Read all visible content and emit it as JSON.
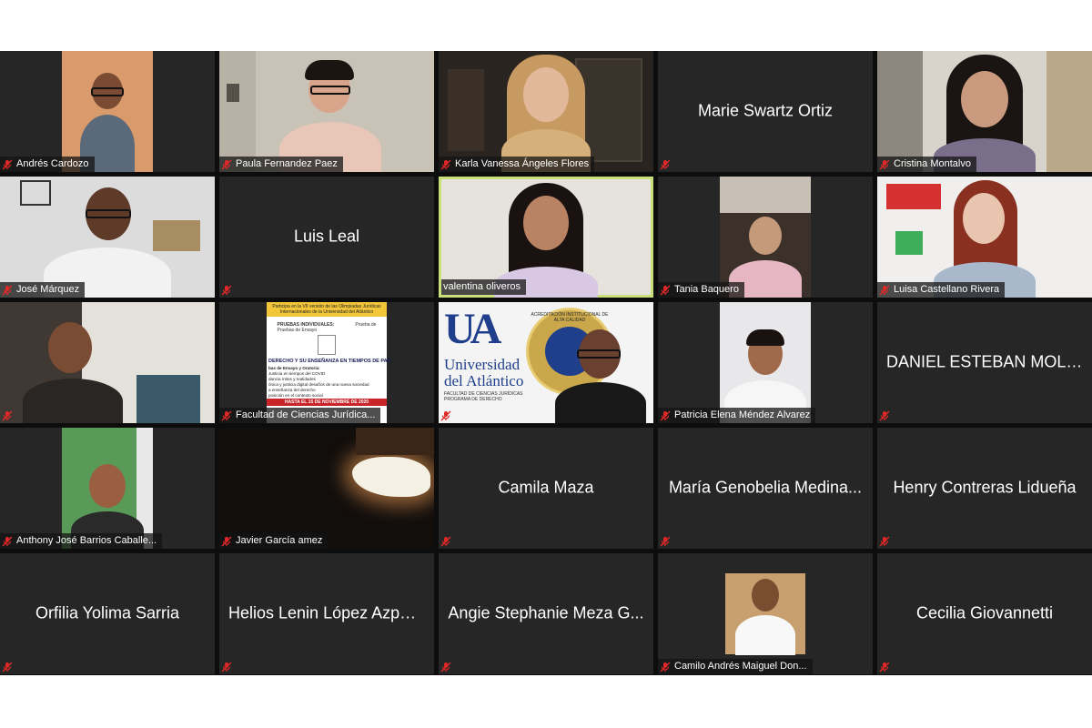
{
  "tiles": [
    {
      "name": "Andrés Cardozo",
      "mode": "video"
    },
    {
      "name": "Paula Fernandez Paez",
      "mode": "video"
    },
    {
      "name": "Karla Vanessa Ángeles Flores",
      "mode": "video"
    },
    {
      "name": "Marie Swartz Ortiz",
      "mode": "name-only"
    },
    {
      "name": "Cristina Montalvo",
      "mode": "video"
    },
    {
      "name": "José Márquez",
      "mode": "video"
    },
    {
      "name": "Luis Leal",
      "mode": "name-only"
    },
    {
      "name": "valentina oliveros",
      "mode": "video",
      "active": true
    },
    {
      "name": "Tania Baquero",
      "mode": "video"
    },
    {
      "name": "Luisa Castellano Rivera",
      "mode": "video"
    },
    {
      "name": "",
      "mode": "video"
    },
    {
      "name": "Facultad de Ciencias Jurídica...",
      "mode": "video"
    },
    {
      "name": "",
      "mode": "video"
    },
    {
      "name": "Patricia Elena Méndez Alvarez",
      "mode": "video"
    },
    {
      "name": "DANIEL ESTEBAN MOLA...",
      "mode": "name-only"
    },
    {
      "name": "Anthony José Barrios Caballe...",
      "mode": "video"
    },
    {
      "name": "Javier García amez",
      "mode": "video"
    },
    {
      "name": "Camila Maza",
      "mode": "name-only"
    },
    {
      "name": "María Genobelia Medina...",
      "mode": "name-only"
    },
    {
      "name": "Henry Contreras Lidueña",
      "mode": "name-only"
    },
    {
      "name": "Orfilia Yolima Sarria",
      "mode": "name-only"
    },
    {
      "name": "Helios Lenin López Azpeit...",
      "mode": "name-only"
    },
    {
      "name": "Angie Stephanie Meza G...",
      "mode": "name-only"
    },
    {
      "name": "Camilo Andrés Maiguel Don...",
      "mode": "video"
    },
    {
      "name": "Cecilia Giovannetti",
      "mode": "name-only"
    }
  ],
  "poster": {
    "line1": "Participa en la VII versión de las Olimpiadas Jurídicas",
    "line2": "Internacionales de la Universidad del Atlántico",
    "col1": "PRUEBAS INDIVIDUALES:",
    "col1b": "Pruebas de Ensayo",
    "col2": "Prueba de",
    "headline": "DERECHO Y SU ENSEÑANZA EN TIEMPOS DE PAN",
    "b1": "bas de Ensayo y Oratoria:",
    "b2": "Justicia en tiempos del COVID",
    "b3": "dancia mitos y realidades",
    "b4": "ónica y justicia digital desafíos de una nueva sociedad",
    "b5": "a enseñanza del derecho",
    "b6": "posición en el contexto social",
    "deadline": "HASTA EL 15 DE NOVIEMBRE DE 2020"
  },
  "banner": {
    "logo_letters": "UA",
    "uni1": "Universidad",
    "uni2": "del Atlántico",
    "seal_text": "ACREDITACIÓN INSTITUCIONAL DE ALTA CALIDAD",
    "fac1": "FACULTAD DE CIENCIAS JURÍDICAS",
    "fac2": "PROGRAMA DE DERECHO"
  },
  "colors": {
    "tile_bg": "#262626",
    "active_border": "#c9e07a",
    "mute_red": "#e02828"
  }
}
